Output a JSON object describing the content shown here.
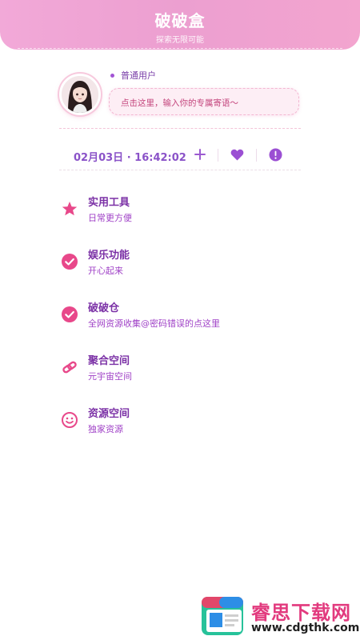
{
  "header": {
    "title": "破破盒",
    "subtitle": "探索无限可能"
  },
  "profile": {
    "avatar_icon": "avatar-icon",
    "user_type": "普通用户",
    "signature_placeholder": "点击这里，输入你的专属寄语～"
  },
  "toolbar": {
    "datetime": "02月03日 · 16:42:02",
    "add_icon": "plus-icon",
    "favorite_icon": "heart-icon",
    "alert_icon": "alert-icon"
  },
  "menu": [
    {
      "icon": "star-icon",
      "title": "实用工具",
      "desc": "日常更方便"
    },
    {
      "icon": "check-circle-icon",
      "title": "娱乐功能",
      "desc": "开心起来"
    },
    {
      "icon": "check-circle-icon",
      "title": "破破仓",
      "desc": "全网资源收集@密码错误的点这里"
    },
    {
      "icon": "link-icon",
      "title": "聚合空间",
      "desc": "元宇宙空间"
    },
    {
      "icon": "smiley-icon",
      "title": "资源空间",
      "desc": "独家资源"
    }
  ],
  "watermark": {
    "text": "睿思下载网",
    "url": "www.cdgthk.com"
  },
  "colors": {
    "header_gradient_start": "#f2a9d8",
    "accent_pink": "#e8488a",
    "accent_purple": "#9b5ad0",
    "title_purple": "#7b31a6"
  }
}
